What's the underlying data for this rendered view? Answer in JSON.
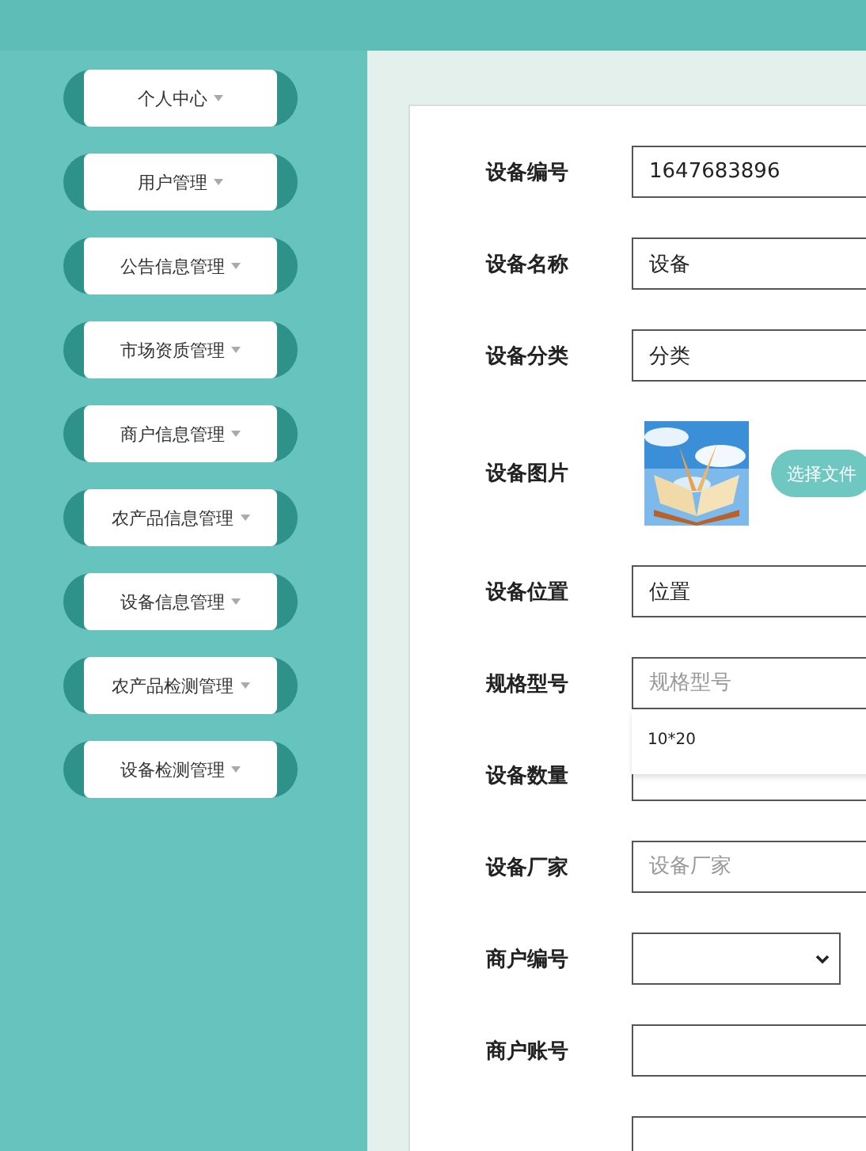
{
  "sidebar": {
    "items": [
      {
        "label": "个人中心"
      },
      {
        "label": "用户管理"
      },
      {
        "label": "公告信息管理"
      },
      {
        "label": "市场资质管理"
      },
      {
        "label": "商户信息管理"
      },
      {
        "label": "农产品信息管理"
      },
      {
        "label": "设备信息管理"
      },
      {
        "label": "农产品检测管理"
      },
      {
        "label": "设备检测管理"
      }
    ]
  },
  "form": {
    "fields": [
      {
        "kind": "text",
        "label": "设备编号",
        "value": "1647683896"
      },
      {
        "kind": "text",
        "label": "设备名称",
        "value": "设备"
      },
      {
        "kind": "text",
        "label": "设备分类",
        "value": "分类"
      },
      {
        "label": "设备图片",
        "button": "选择文件"
      },
      {
        "kind": "text",
        "label": "设备位置",
        "value": "位置"
      },
      {
        "kind": "text",
        "label": "规格型号",
        "placeholder": "规格型号",
        "suggestion": "10*20"
      },
      {
        "kind": "text",
        "label": "设备数量"
      },
      {
        "kind": "text",
        "label": "设备厂家",
        "placeholder": "设备厂家"
      },
      {
        "kind": "select",
        "label": "商户编号"
      },
      {
        "kind": "text",
        "label": "商户账号"
      },
      {
        "kind": "text"
      }
    ]
  }
}
